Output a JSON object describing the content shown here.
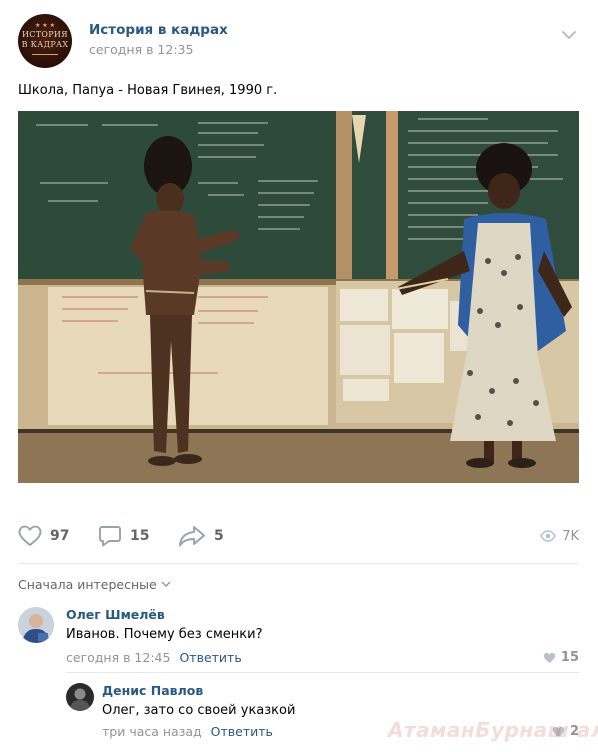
{
  "post": {
    "group_name": "История в кадрах",
    "time": "сегодня в 12:35",
    "text": "Школа, Папуа - Новая Гвинея, 1990 г.",
    "avatar_logo_text": "ИСТОРИЯ В КАДРАХ",
    "image_alt": "Photo: classroom in Papua New Guinea — a boy in traditional dress and a teacher in a patterned dress at the blackboard"
  },
  "actions": {
    "likes": "97",
    "comments": "15",
    "shares": "5",
    "views": "7K"
  },
  "comments_sort": "Сначала интересные",
  "comments": [
    {
      "author": "Олег Шмелёв",
      "text": "Иванов. Почему без сменки?",
      "time": "сегодня в 12:45",
      "reply_label": "Ответить",
      "likes": "15"
    },
    {
      "author": "Денис Павлов",
      "text": "Олег, зато со своей указкой",
      "time": "три часа назад",
      "reply_label": "Ответить",
      "likes": "2"
    }
  ],
  "watermark": "АтаманБурнаш али ЯП",
  "colors": {
    "link": "#2a5885",
    "secondary": "#939393",
    "icon": "#99a2ad",
    "divider": "#e7e8ec"
  },
  "icons": [
    "chevron-down-icon",
    "heart-icon",
    "comment-icon",
    "share-icon",
    "eye-icon"
  ]
}
